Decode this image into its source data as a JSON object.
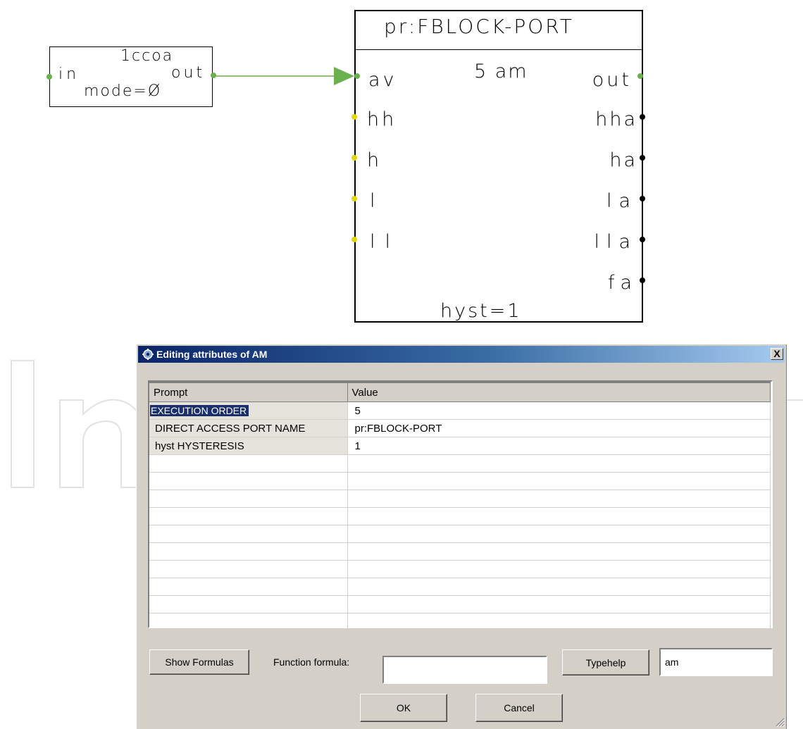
{
  "diagram": {
    "small_block": {
      "title": "1ccoa",
      "in_label": "in",
      "out_label": "out",
      "param": "mode=Ø"
    },
    "big_block": {
      "title": "pr:FBLOCK-PORT",
      "order": "5 am",
      "inputs": [
        "av",
        "hh",
        "h",
        "l",
        "ll"
      ],
      "outputs": [
        "out",
        "hha",
        "ha",
        "la",
        "lla",
        "fa"
      ],
      "param": "hyst=1"
    },
    "colors": {
      "connection": "#6ab04c",
      "input_port": "#e4d600",
      "output_port": "#000000"
    }
  },
  "dialog": {
    "title": "Editing attributes of AM",
    "close_label": "X",
    "columns": [
      "Prompt",
      "Value"
    ],
    "rows": [
      {
        "prompt": "EXECUTION ORDER",
        "value": "5",
        "selected": true
      },
      {
        "prompt": "DIRECT ACCESS PORT NAME",
        "value": "pr:FBLOCK-PORT"
      },
      {
        "prompt": "hyst HYSTERESIS",
        "value": "1"
      }
    ],
    "show_formulas_label": "Show Formulas",
    "function_formula_label": "Function formula:",
    "function_formula_value": "",
    "typehelp_label": "Typehelp",
    "type_value": "am",
    "ok_label": "OK",
    "cancel_label": "Cancel",
    "colors": {
      "title_start": "#0a246a",
      "title_end": "#a6caf0",
      "face": "#d4d0c8",
      "selection": "#1a2f6b"
    }
  }
}
